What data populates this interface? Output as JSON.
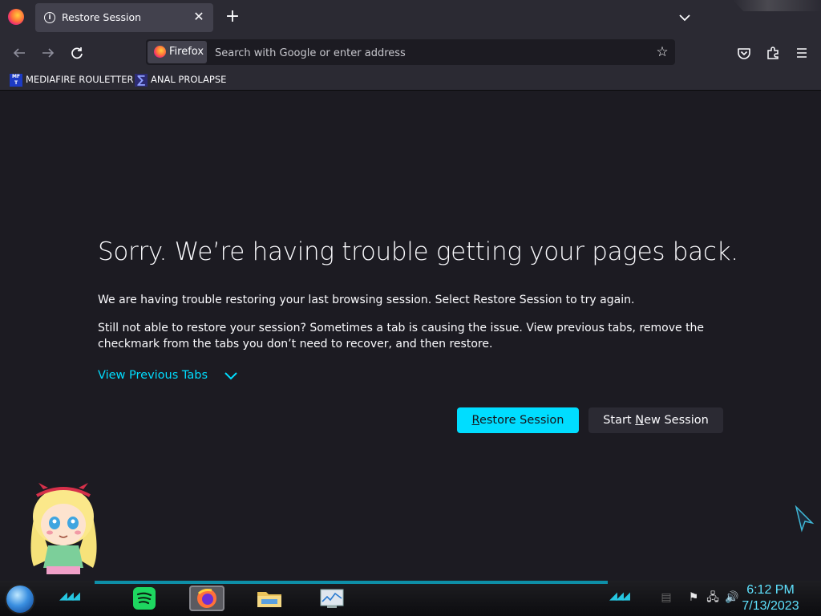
{
  "browser": {
    "tab": {
      "title": "Restore Session"
    },
    "urlbar": {
      "identity_label": "Firefox",
      "placeholder": "Search with Google or enter address"
    },
    "bookmarks": [
      {
        "label": "MEDIAFIRE ROULETTER",
        "favicon_text": "MF T"
      },
      {
        "label": "ANAL PROLAPSE",
        "favicon_text": "∑"
      }
    ],
    "accent_color": "#00ddff"
  },
  "page": {
    "title": "Sorry. We’re having trouble getting your pages back.",
    "paragraph1": "We are having trouble restoring your last browsing session. Select Restore Session to try again.",
    "paragraph2": "Still not able to restore your session? Sometimes a tab is causing the issue. View previous tabs, remove the checkmark from the tabs you don’t need to recover, and then restore.",
    "view_previous_tabs": "View Previous Tabs",
    "restore_button": {
      "accesskey": "R",
      "rest": "estore Session"
    },
    "new_session_button": {
      "before": "Start ",
      "accesskey": "N",
      "after": "ew Session"
    }
  },
  "taskbar": {
    "clock_time": "6:12 PM",
    "clock_date": "7/13/2023",
    "pinned_apps": [
      "spotify-icon",
      "firefox-icon",
      "file-explorer-icon",
      "task-manager-icon"
    ]
  }
}
